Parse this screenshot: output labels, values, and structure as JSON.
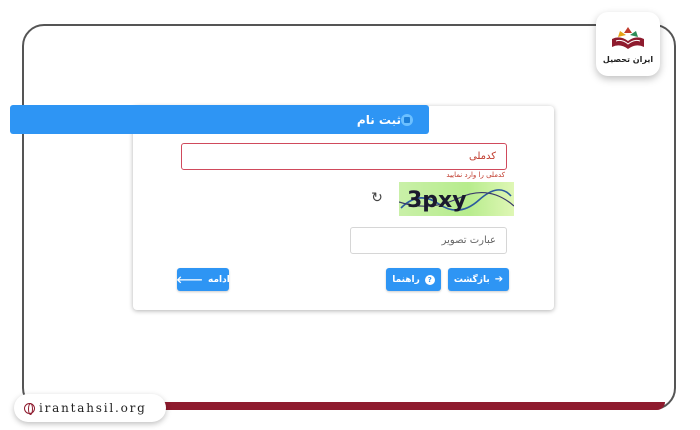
{
  "form": {
    "title": "ثبت نام",
    "name_value": "کدملی",
    "error": "کدملی را وارد نمایید",
    "captcha_text": "3pxy",
    "captcha_placeholder": "عبارت تصویر",
    "refresh_glyph": "↻"
  },
  "buttons": {
    "back_label": "بازگشت",
    "help_label": "راهنما",
    "next_label": "ادامه",
    "back_icon": "➔",
    "next_icon": "🡐",
    "help_icon": "?"
  },
  "branding": {
    "logo_text": "ایران تحصیل",
    "website": "irantahsil.org"
  },
  "colors": {
    "accent": "#2e95f4",
    "brand": "#8e1b2e",
    "error": "#c0392b"
  }
}
